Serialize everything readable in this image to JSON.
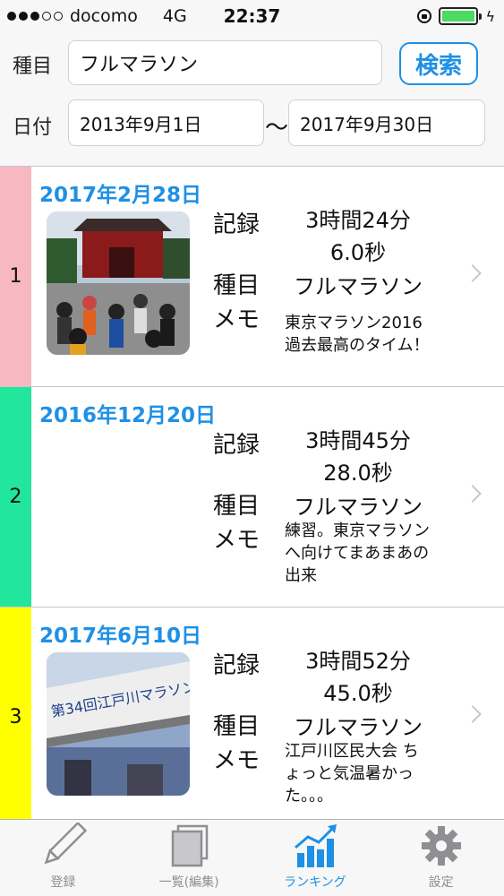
{
  "status_bar": {
    "carrier": "docomo",
    "network": "4G",
    "time": "22:37"
  },
  "search": {
    "event_label": "種目",
    "event_value": "フルマラソン",
    "search_button": "検索",
    "date_label": "日付",
    "date_from": "2013年9月1日",
    "date_separator": "〜",
    "date_to": "2017年9月30日"
  },
  "ranking": [
    {
      "rank": "1",
      "rank_color": "#f8b8c0",
      "date": "2017年2月28日",
      "record_label": "記録",
      "record_line1": "3時間24分",
      "record_line2": "6.0秒",
      "event_label": "種目",
      "event": "フルマラソン",
      "memo_label": "メモ",
      "memo": "東京マラソン2016\n過去最高のタイム！"
    },
    {
      "rank": "2",
      "rank_color": "#22e69b",
      "date": "2016年12月20日",
      "record_label": "記録",
      "record_line1": "3時間45分",
      "record_line2": "28.0秒",
      "event_label": "種目",
      "event": "フルマラソン",
      "memo_label": "メモ",
      "memo": "練習。東京マラソン\nへ向けてまあまあの\n出来"
    },
    {
      "rank": "3",
      "rank_color": "#ffff00",
      "date": "2017年6月10日",
      "record_label": "記録",
      "record_line1": "3時間52分",
      "record_line2": "45.0秒",
      "event_label": "種目",
      "event": "フルマラソン",
      "memo_label": "メモ",
      "memo": "江戸川区民大会 ち\nょっと気温暑かっ\nた。。。"
    }
  ],
  "tabs": [
    {
      "label": "登録",
      "icon": "pencil-icon",
      "active": false
    },
    {
      "label": "一覧(編集)",
      "icon": "photo-stack-icon",
      "active": false
    },
    {
      "label": "ランキング",
      "icon": "chart-icon",
      "active": true
    },
    {
      "label": "設定",
      "icon": "gear-icon",
      "active": false
    }
  ],
  "colors": {
    "accent": "#1e90e6",
    "battery": "#4cd964"
  }
}
